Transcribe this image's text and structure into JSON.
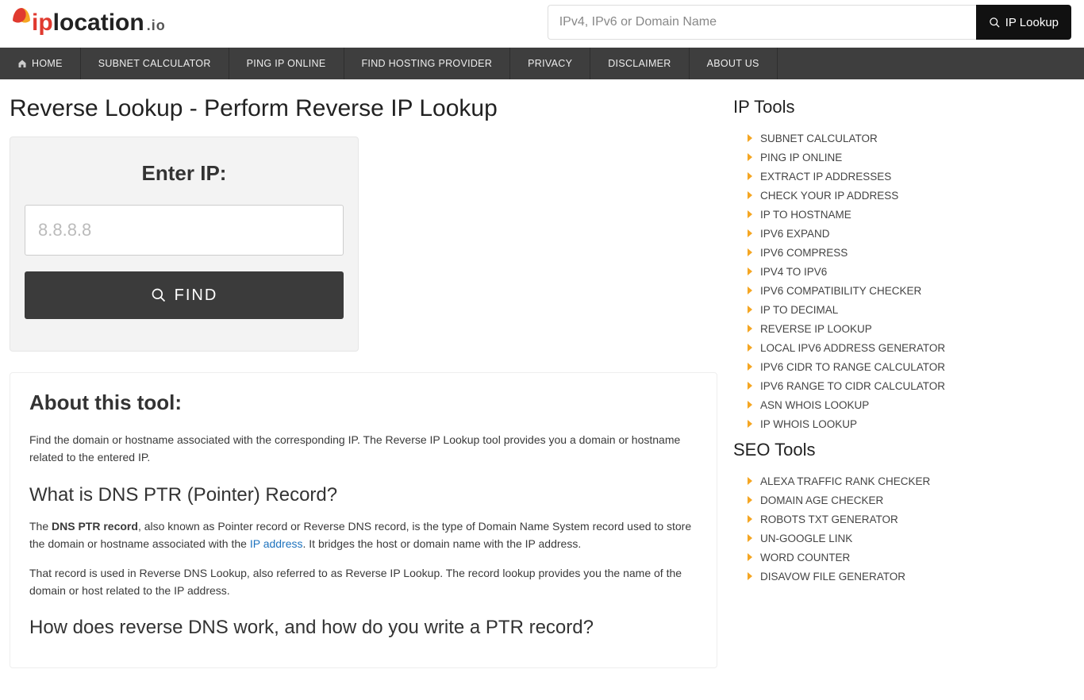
{
  "header": {
    "logo": {
      "part1": "ip",
      "part2": "location",
      "part3": ".io"
    },
    "search": {
      "placeholder": "IPv4, IPv6 or Domain Name",
      "button": "IP Lookup"
    }
  },
  "nav": [
    "HOME",
    "SUBNET CALCULATOR",
    "PING IP ONLINE",
    "FIND HOSTING PROVIDER",
    "PRIVACY",
    "DISCLAIMER",
    "ABOUT US"
  ],
  "page_title": "Reverse Lookup - Perform Reverse IP Lookup",
  "panel": {
    "heading": "Enter IP:",
    "placeholder": "8.8.8.8",
    "button": "FIND"
  },
  "article": {
    "h2": "About this tool:",
    "p1": "Find the domain or hostname associated with the corresponding IP. The Reverse IP Lookup tool provides you a domain or hostname related to the entered IP.",
    "h3a": "What is DNS PTR (Pointer) Record?",
    "p2_a": "The ",
    "p2_b": "DNS PTR record",
    "p2_c": ", also known as Pointer record or Reverse DNS record, is the type of Domain Name System record used to store the domain or hostname associated with the ",
    "p2_link": "IP address",
    "p2_d": ". It bridges the host or domain name with the IP address.",
    "p3": "That record is used in Reverse DNS Lookup, also referred to as Reverse IP Lookup. The record lookup provides you the name of the domain or host related to the IP address.",
    "h3b": "How does reverse DNS work, and how do you write a PTR record?"
  },
  "sidebar": {
    "ip_title": "IP Tools",
    "ip_tools": [
      "SUBNET CALCULATOR",
      "PING IP ONLINE",
      "EXTRACT IP ADDRESSES",
      "CHECK YOUR IP ADDRESS",
      "IP TO HOSTNAME",
      "IPV6 EXPAND",
      "IPV6 COMPRESS",
      "IPV4 TO IPV6",
      "IPV6 COMPATIBILITY CHECKER",
      "IP TO DECIMAL",
      "REVERSE IP LOOKUP",
      "LOCAL IPV6 ADDRESS GENERATOR",
      "IPV6 CIDR TO RANGE CALCULATOR",
      "IPV6 RANGE TO CIDR CALCULATOR",
      "ASN WHOIS LOOKUP",
      "IP WHOIS LOOKUP"
    ],
    "seo_title": "SEO Tools",
    "seo_tools": [
      "ALEXA TRAFFIC RANK CHECKER",
      "DOMAIN AGE CHECKER",
      "ROBOTS TXT GENERATOR",
      "UN-GOOGLE LINK",
      "WORD COUNTER",
      "DISAVOW FILE GENERATOR"
    ]
  }
}
